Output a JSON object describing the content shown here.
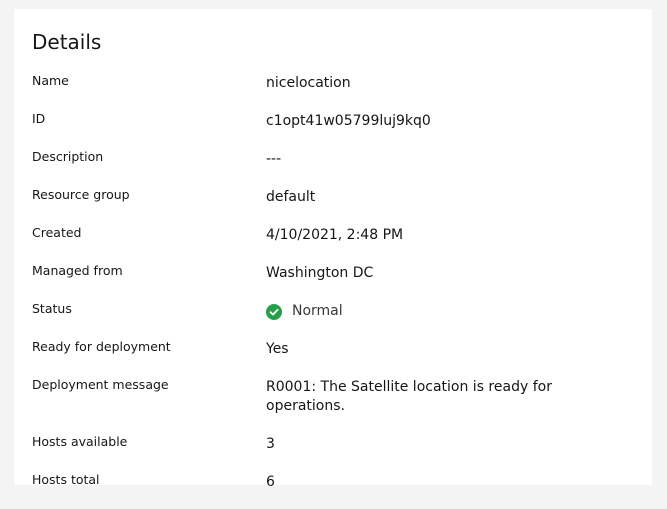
{
  "panel": {
    "title": "Details"
  },
  "details": [
    {
      "label": "Name",
      "value": "nicelocation"
    },
    {
      "label": "ID",
      "value": "c1opt41w05799luj9kq0"
    },
    {
      "label": "Description",
      "value": "---"
    },
    {
      "label": "Resource group",
      "value": "default"
    },
    {
      "label": "Created",
      "value": "4/10/2021, 2:48 PM"
    },
    {
      "label": "Managed from",
      "value": "Washington DC"
    },
    {
      "label": "Status",
      "value": "Normal",
      "icon": "check-circle-icon",
      "icon_color": "#24a148"
    },
    {
      "label": "Ready for deployment",
      "value": "Yes"
    },
    {
      "label": "Deployment message",
      "value": "R0001: The Satellite location is ready for operations."
    },
    {
      "label": "Hosts available",
      "value": "3"
    },
    {
      "label": "Hosts total",
      "value": "6"
    }
  ]
}
